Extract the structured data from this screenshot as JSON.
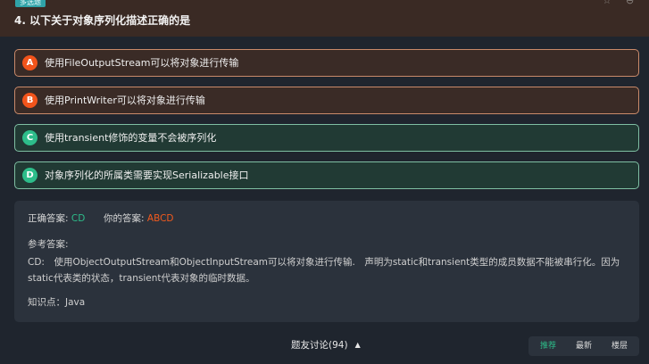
{
  "header": {
    "question_type": "多选题",
    "icons": [
      "star-outline-icon",
      "minus-circle-icon"
    ]
  },
  "question": {
    "title": "4. 以下关于对象序列化描述正确的是"
  },
  "options": [
    {
      "letter": "A",
      "text": "使用FileOutputStream可以将对象进行传输",
      "state": "wrong"
    },
    {
      "letter": "B",
      "text": "使用PrintWriter可以将对象进行传输",
      "state": "wrong"
    },
    {
      "letter": "C",
      "text": "使用transient修饰的变量不会被序列化",
      "state": "right"
    },
    {
      "letter": "D",
      "text": "对象序列化的所属类需要实现Serializable接口",
      "state": "right"
    }
  ],
  "answer": {
    "correct_label": "正确答案:",
    "correct_value": "CD",
    "yours_label": "你的答案:",
    "yours_value": "ABCD",
    "ref_label": "参考答案:",
    "ref_text": "CD:　使用ObjectOutputStream和ObjectInputStream可以将对象进行传输.　声明为static和transient类型的成员数据不能被串行化。因为static代表类的状态，transient代表对象的临时数据。",
    "knowledge": "知识点：Java"
  },
  "discussion": {
    "label": "题友讨论(94)",
    "toggle_icon": "triangle-up-icon"
  },
  "sort": {
    "options": [
      "推荐",
      "最新",
      "楼层"
    ],
    "active": "推荐"
  },
  "colors": {
    "accent_green": "#2dbd8a",
    "accent_orange": "#f2541b"
  }
}
